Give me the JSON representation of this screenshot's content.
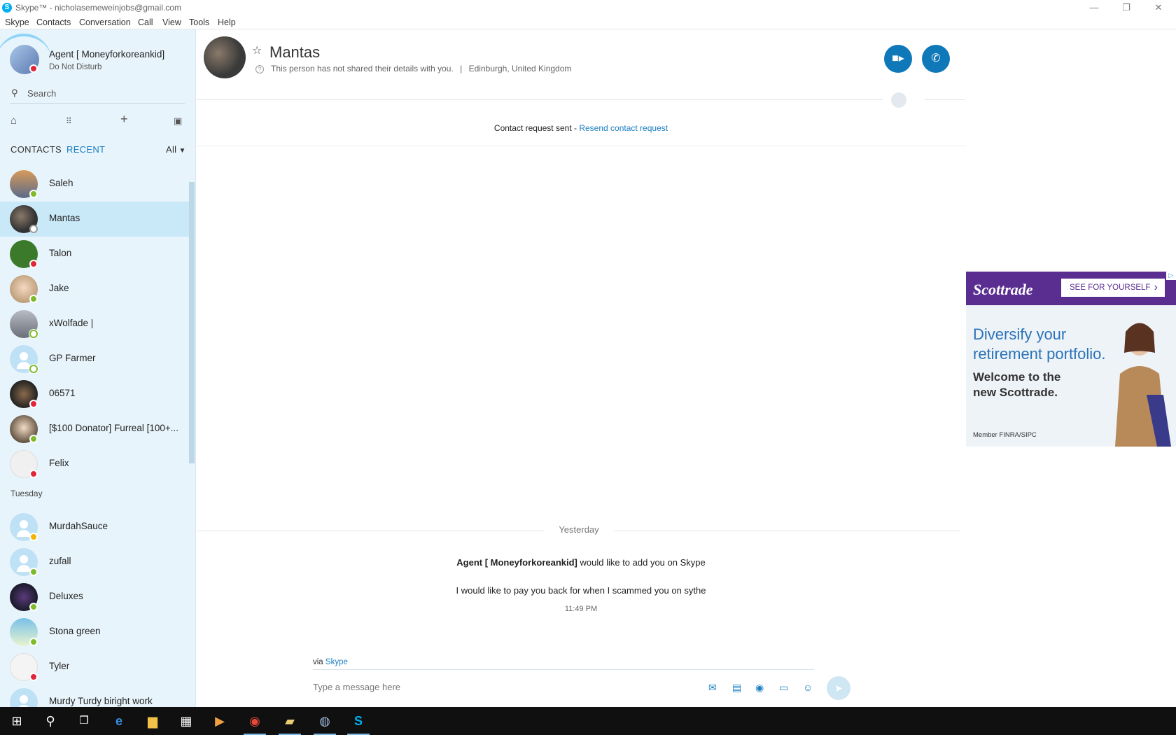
{
  "window": {
    "title": "Skype™ - nicholasemeweinjobs@gmail.com",
    "logo_letter": "S",
    "minimize": "—",
    "restore": "❐",
    "close": "✕"
  },
  "menu": [
    "Skype",
    "Contacts",
    "Conversation",
    "Call",
    "View",
    "Tools",
    "Help"
  ],
  "profile": {
    "name": "Agent [ Moneyforkoreankid]",
    "status": "Do Not Disturb"
  },
  "search": {
    "placeholder": "Search",
    "icon": "search-icon"
  },
  "toolbar_icons": [
    "home-icon",
    "dialpad-icon",
    "add-icon",
    "contacts-book-icon"
  ],
  "tabs": {
    "contacts": "CONTACTS",
    "recent": "RECENT",
    "filter": "All"
  },
  "contacts_recent": [
    {
      "name": "Saleh",
      "status": "online"
    },
    {
      "name": "Mantas",
      "status": "unknown",
      "selected": true
    },
    {
      "name": "Talon",
      "status": "dnd"
    },
    {
      "name": "Jake",
      "status": "online"
    },
    {
      "name": "xWolfade |",
      "status": "offline"
    },
    {
      "name": "GP Farmer",
      "status": "offline"
    },
    {
      "name": "06571",
      "status": "dnd"
    },
    {
      "name": "[$100 Donator] Furreal [100+...",
      "status": "online"
    },
    {
      "name": "Felix",
      "status": "dnd"
    }
  ],
  "section_tuesday": "Tuesday",
  "contacts_tuesday": [
    {
      "name": "MurdahSauce",
      "status": "away"
    },
    {
      "name": "zufall",
      "status": "online"
    },
    {
      "name": "Deluxes",
      "status": "online"
    },
    {
      "name": "Stona green",
      "status": "online"
    },
    {
      "name": "Tyler",
      "status": "dnd"
    },
    {
      "name": "Murdy Turdy biright work",
      "status": "online"
    }
  ],
  "conversation": {
    "name": "Mantas",
    "details": "This person has not shared their details with you.",
    "separator": "|",
    "location": "Edinburgh, United Kingdom",
    "request_text": "Contact request sent - ",
    "request_link": "Resend contact request",
    "day": "Yesterday",
    "msg_sender": "Agent [ Moneyforkoreankid]",
    "msg_action": " would like to add you on Skype",
    "msg_body": "I would like to pay you back for when I scammed you on sythe",
    "msg_time": "11:49 PM",
    "via_label": "via ",
    "via_link": "Skype",
    "compose_placeholder": "Type a message here"
  },
  "ad": {
    "brand": "Scottrade",
    "cta": "SEE FOR YOURSELF",
    "cta_arrow": "›",
    "headline_1": "Diversify your",
    "headline_2": "retirement portfolio.",
    "sub_1": "Welcome to the",
    "sub_2": "new Scottrade.",
    "fine": "Member FINRA/SIPC",
    "badge": "▷"
  },
  "taskbar": [
    "windows-start-icon",
    "search-icon",
    "task-view-icon",
    "edge-icon",
    "file-explorer-icon",
    "store-icon",
    "media-player-icon",
    "chrome-icon",
    "folder-icon",
    "steam-icon",
    "skype-icon"
  ],
  "colors": {
    "accent": "#0f78b8",
    "link": "#1a7dc0",
    "sidebar": "#e8f4fb",
    "selected": "#c9e8f8",
    "dnd": "#e2263a",
    "online": "#7dbb2c",
    "ad_purple": "#5a2d91"
  }
}
